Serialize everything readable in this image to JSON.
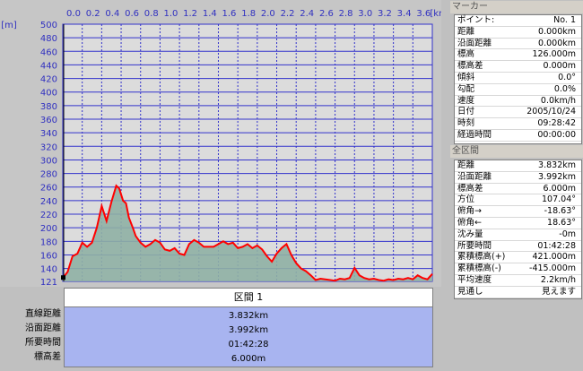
{
  "chart_data": {
    "type": "area",
    "xlabel": "km",
    "ylabel": "m",
    "x_ticks": [
      "0.0",
      "0.2",
      "0.4",
      "0.6",
      "0.8",
      "1.0",
      "1.2",
      "1.4",
      "1.6",
      "1.8",
      "2.0",
      "2.2",
      "2.4",
      "2.6",
      "2.8",
      "3.0",
      "3.2",
      "3.4",
      "3.6"
    ],
    "y_ticks": [
      "500",
      "480",
      "460",
      "440",
      "420",
      "400",
      "380",
      "360",
      "340",
      "320",
      "300",
      "280",
      "260",
      "240",
      "220",
      "200",
      "180",
      "160",
      "140",
      "121"
    ],
    "xlim": [
      0,
      3.8
    ],
    "ylim": [
      121,
      500
    ],
    "grid": true,
    "series": [
      {
        "x": [
          0,
          0.05,
          0.1,
          0.15,
          0.2,
          0.25,
          0.3,
          0.35,
          0.4,
          0.45,
          0.5,
          0.55,
          0.58,
          0.62,
          0.65,
          0.68,
          0.72,
          0.75,
          0.8,
          0.85,
          0.9,
          0.95,
          1.0,
          1.05,
          1.1,
          1.15,
          1.2,
          1.25,
          1.3,
          1.35,
          1.4,
          1.45,
          1.5,
          1.55,
          1.6,
          1.65,
          1.7,
          1.75,
          1.8,
          1.85,
          1.9,
          1.95,
          2.0,
          2.05,
          2.1,
          2.15,
          2.2,
          2.25,
          2.3,
          2.35,
          2.4,
          2.45,
          2.5,
          2.55,
          2.6,
          2.65,
          2.7,
          2.75,
          2.8,
          2.85,
          2.9,
          2.95,
          3.0,
          3.05,
          3.1,
          3.15,
          3.2,
          3.25,
          3.3,
          3.35,
          3.4,
          3.45,
          3.5,
          3.55,
          3.6,
          3.65,
          3.7,
          3.75,
          3.8
        ],
        "values": [
          126,
          135,
          158,
          162,
          178,
          172,
          178,
          200,
          232,
          210,
          238,
          262,
          258,
          240,
          236,
          215,
          200,
          188,
          178,
          172,
          176,
          182,
          178,
          168,
          166,
          170,
          162,
          160,
          176,
          182,
          178,
          172,
          172,
          172,
          176,
          180,
          176,
          178,
          170,
          172,
          176,
          170,
          174,
          168,
          158,
          150,
          162,
          170,
          176,
          160,
          148,
          140,
          136,
          130,
          123,
          125,
          124,
          123,
          122,
          125,
          124,
          126,
          141,
          130,
          126,
          124,
          125,
          123,
          122,
          124,
          123,
          125,
          124,
          126,
          124,
          130,
          126,
          124,
          132
        ]
      }
    ]
  },
  "bottom": {
    "section_title": "区間 1",
    "rows": [
      {
        "label": "直線距離",
        "value": "3.832km"
      },
      {
        "label": "沿面距離",
        "value": "3.992km"
      },
      {
        "label": "所要時間",
        "value": "01:42:28"
      },
      {
        "label": "標高差",
        "value": "6.000m"
      }
    ]
  },
  "marker": {
    "title": "マーカー",
    "rows": [
      {
        "k": "ポイント:",
        "v": "No. 1"
      },
      {
        "k": "距離",
        "v": "0.000km"
      },
      {
        "k": "沿面距離",
        "v": "0.000km"
      },
      {
        "k": "標高",
        "v": "126.000m"
      },
      {
        "k": "標高差",
        "v": "0.000m"
      },
      {
        "k": "傾斜",
        "v": "0.0°"
      },
      {
        "k": "勾配",
        "v": "0.0%"
      },
      {
        "k": "速度",
        "v": "0.0km/h"
      },
      {
        "k": "日付",
        "v": "2005/10/24"
      },
      {
        "k": "時刻",
        "v": "09:28:42"
      },
      {
        "k": "経過時間",
        "v": "00:00:00"
      }
    ]
  },
  "total": {
    "title": "全区間",
    "rows": [
      {
        "k": "距離",
        "v": "3.832km"
      },
      {
        "k": "沿面距離",
        "v": "3.992km"
      },
      {
        "k": "標高差",
        "v": "6.000m"
      },
      {
        "k": "方位",
        "v": "107.04°"
      },
      {
        "k": "俯角→",
        "v": "-18.63°"
      },
      {
        "k": "俯角←",
        "v": "18.63°"
      },
      {
        "k": "沈み量",
        "v": "-0m"
      },
      {
        "k": "所要時間",
        "v": "01:42:28"
      },
      {
        "k": "累積標高(+)",
        "v": "421.000m"
      },
      {
        "k": "累積標高(-)",
        "v": "-415.000m"
      },
      {
        "k": "平均速度",
        "v": "2.2km/h"
      },
      {
        "k": "見通し",
        "v": "見えます"
      }
    ]
  },
  "colors": {
    "plot_bg": "#dcdcdc",
    "grid": "#3333cc",
    "line": "#ff0000",
    "fill": "#8fb0a4",
    "rows_bg": "#a8b4f0"
  }
}
